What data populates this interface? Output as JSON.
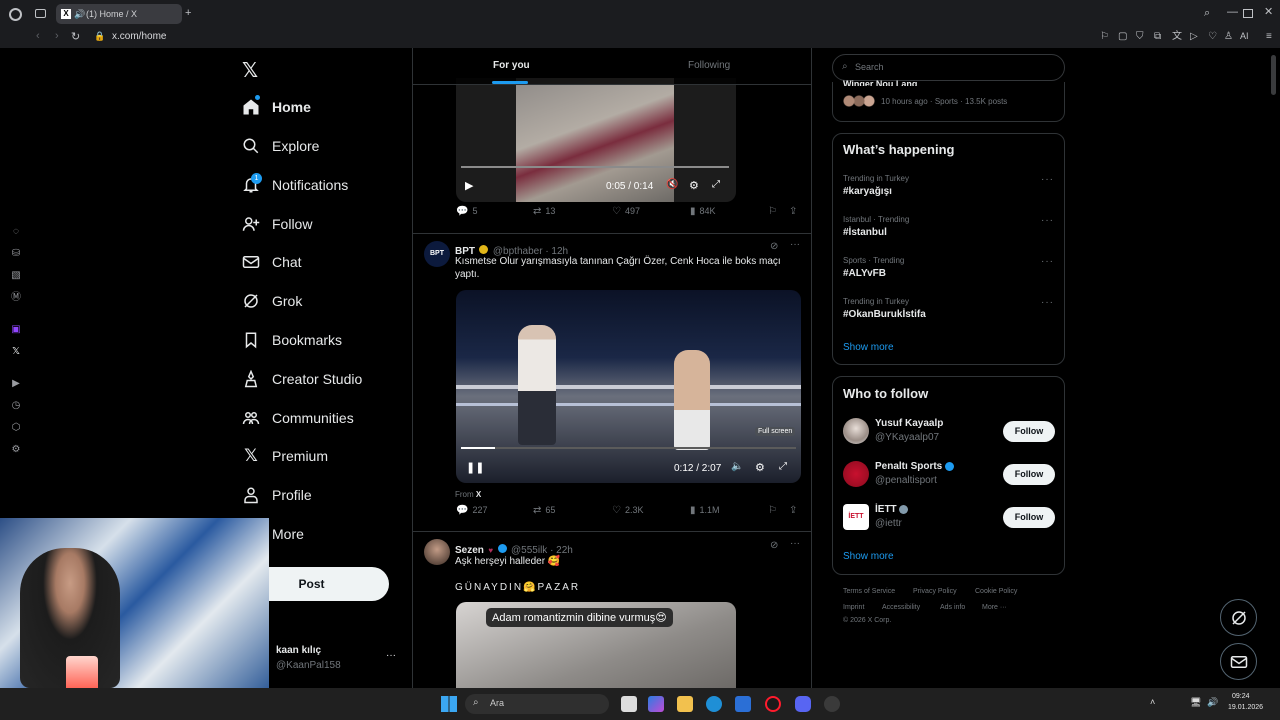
{
  "browser": {
    "tab_title": "(1) Home / X",
    "url": "x.com/home",
    "ai_label": "AI"
  },
  "nav": {
    "items": [
      {
        "label": "Home"
      },
      {
        "label": "Explore"
      },
      {
        "label": "Notifications",
        "badge": "1"
      },
      {
        "label": "Follow"
      },
      {
        "label": "Chat"
      },
      {
        "label": "Grok"
      },
      {
        "label": "Bookmarks"
      },
      {
        "label": "Creator Studio"
      },
      {
        "label": "Communities"
      },
      {
        "label": "Premium"
      },
      {
        "label": "Profile"
      },
      {
        "label": "More"
      }
    ],
    "post_label": "Post",
    "account": {
      "name": "kaan kılıç",
      "handle": "@KaanPal158"
    }
  },
  "feed": {
    "tabs": {
      "for_you": "For you",
      "following": "Following"
    },
    "video1": {
      "time": "0:05 / 0:14"
    },
    "tweet0_actions": {
      "replies": "5",
      "reposts": "13",
      "likes": "497",
      "views": "84K"
    },
    "tweet1": {
      "name": "BPT",
      "handle": "@bpthaber · 12h",
      "text": "Kısmetse Olur yarışmasıyla tanınan Çağrı Özer, Cenk Hoca ile boks maçı yaptı.",
      "video_time": "0:12 / 2:07",
      "tooltip": "Full screen",
      "from_label": "From",
      "from_source": "X",
      "replies": "227",
      "reposts": "65",
      "likes": "2.3K",
      "views": "1.1M"
    },
    "tweet2": {
      "name": "Sezen",
      "handle": "@555ilk · 22h",
      "text1": "Aşk herşeyi halleder 🥰",
      "text2": "GÜNAYDIN🤗PAZAR",
      "caption": "Adam romantizmin dibine vurmuş😍"
    }
  },
  "right": {
    "search_placeholder": "Search",
    "top_card": {
      "title": "Winger Nou Lang",
      "meta": "10 hours ago · Sports · 13.5K posts"
    },
    "happening_title": "What’s happening",
    "trends": [
      {
        "meta": "Trending in Turkey",
        "name": "#karyağışı"
      },
      {
        "meta": "Istanbul · Trending",
        "name": "#İstanbul"
      },
      {
        "meta": "Sports · Trending",
        "name": "#ALYvFB"
      },
      {
        "meta": "Trending in Turkey",
        "name": "#OkanBurukİstifa"
      }
    ],
    "show_more": "Show more",
    "wtf_title": "Who to follow",
    "wtf": [
      {
        "name": "Yusuf Kayaalp",
        "handle": "@YKayaalp07",
        "button": "Follow"
      },
      {
        "name": "Penaltı Sports",
        "handle": "@penaltisport",
        "button": "Follow"
      },
      {
        "name": "İETT",
        "handle": "@iettr",
        "button": "Follow"
      }
    ],
    "wtf_show_more": "Show more",
    "footer": [
      "Terms of Service",
      "Privacy Policy",
      "Cookie Policy",
      "Imprint",
      "Accessibility",
      "Ads info",
      "More ···",
      "© 2026 X Corp."
    ]
  },
  "taskbar": {
    "search_label": "Ara",
    "time": "09:24",
    "date": "19.01.2026"
  },
  "colors": {
    "accent": "#1d9bf0",
    "bg": "#000000",
    "text": "#e7e9ea",
    "muted": "#71767b"
  }
}
